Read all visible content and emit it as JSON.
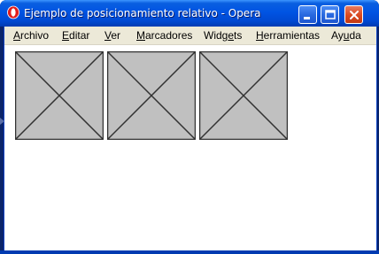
{
  "window": {
    "title": "Ejemplo de posicionamiento relativo - Opera",
    "app_icon": "opera-icon",
    "controls": {
      "minimize_icon": "minimize-icon",
      "maximize_icon": "maximize-icon",
      "close_icon": "close-icon"
    }
  },
  "menubar": {
    "items": [
      {
        "label_u": "A",
        "label_rest": "rchivo"
      },
      {
        "label_u": "E",
        "label_rest": "ditar"
      },
      {
        "label_u": "V",
        "label_rest": "er"
      },
      {
        "label_u": "M",
        "label_rest": "arcadores"
      },
      {
        "label_pre": "Widg",
        "label_u": "e",
        "label_rest": "ts"
      },
      {
        "label_u": "H",
        "label_rest": "erramientas"
      },
      {
        "label_pre": "Ay",
        "label_u": "u",
        "label_rest": "da"
      }
    ]
  },
  "content": {
    "images": [
      {
        "kind": "image-placeholder",
        "fill": "#c0c0c0",
        "stroke": "#333333"
      },
      {
        "kind": "image-placeholder",
        "fill": "#c0c0c0",
        "stroke": "#333333"
      },
      {
        "kind": "image-placeholder",
        "fill": "#c0c0c0",
        "stroke": "#333333"
      }
    ]
  },
  "colors": {
    "titlebar": "#0054e3",
    "menubar": "#ece9d8",
    "close_button": "#d9491f"
  }
}
